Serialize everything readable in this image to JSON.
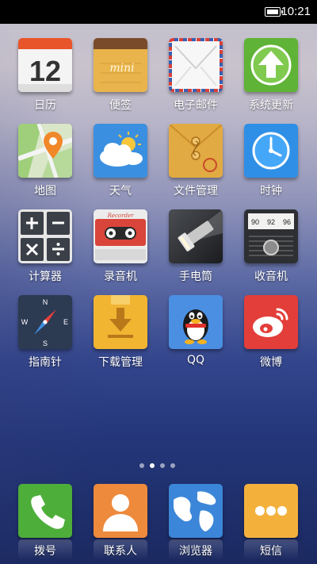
{
  "status_bar": {
    "time": "10:21",
    "battery_icon": "battery-icon"
  },
  "apps": [
    {
      "id": "calendar",
      "label": "日历",
      "icon": "calendar-icon",
      "date": "12"
    },
    {
      "id": "notes",
      "label": "便签",
      "icon": "notes-icon",
      "brand": "mini"
    },
    {
      "id": "email",
      "label": "电子邮件",
      "icon": "envelope-icon"
    },
    {
      "id": "updater",
      "label": "系统更新",
      "icon": "up-arrow-icon"
    },
    {
      "id": "maps",
      "label": "地图",
      "icon": "map-pin-icon"
    },
    {
      "id": "weather",
      "label": "天气",
      "icon": "weather-icon"
    },
    {
      "id": "files",
      "label": "文件管理",
      "icon": "folder-envelope-icon"
    },
    {
      "id": "clock",
      "label": "时钟",
      "icon": "clock-icon"
    },
    {
      "id": "calculator",
      "label": "计算器",
      "icon": "calculator-icon"
    },
    {
      "id": "recorder",
      "label": "录音机",
      "icon": "cassette-icon",
      "brand": "Recorder"
    },
    {
      "id": "flashlight",
      "label": "手电筒",
      "icon": "flashlight-icon"
    },
    {
      "id": "radio",
      "label": "收音机",
      "icon": "radio-icon",
      "dial": [
        "90",
        "92",
        "96"
      ]
    },
    {
      "id": "compass",
      "label": "指南针",
      "icon": "compass-icon"
    },
    {
      "id": "downloads",
      "label": "下载管理",
      "icon": "download-icon"
    },
    {
      "id": "qq",
      "label": "QQ",
      "icon": "qq-penguin-icon"
    },
    {
      "id": "weibo",
      "label": "微博",
      "icon": "weibo-icon"
    }
  ],
  "page_indicator": {
    "count": 4,
    "active": 2
  },
  "dock": [
    {
      "id": "dialer",
      "label": "拨号",
      "icon": "phone-icon"
    },
    {
      "id": "contacts",
      "label": "联系人",
      "icon": "contact-icon"
    },
    {
      "id": "browser",
      "label": "浏览器",
      "icon": "globe-icon"
    },
    {
      "id": "messaging",
      "label": "短信",
      "icon": "message-icon"
    }
  ]
}
